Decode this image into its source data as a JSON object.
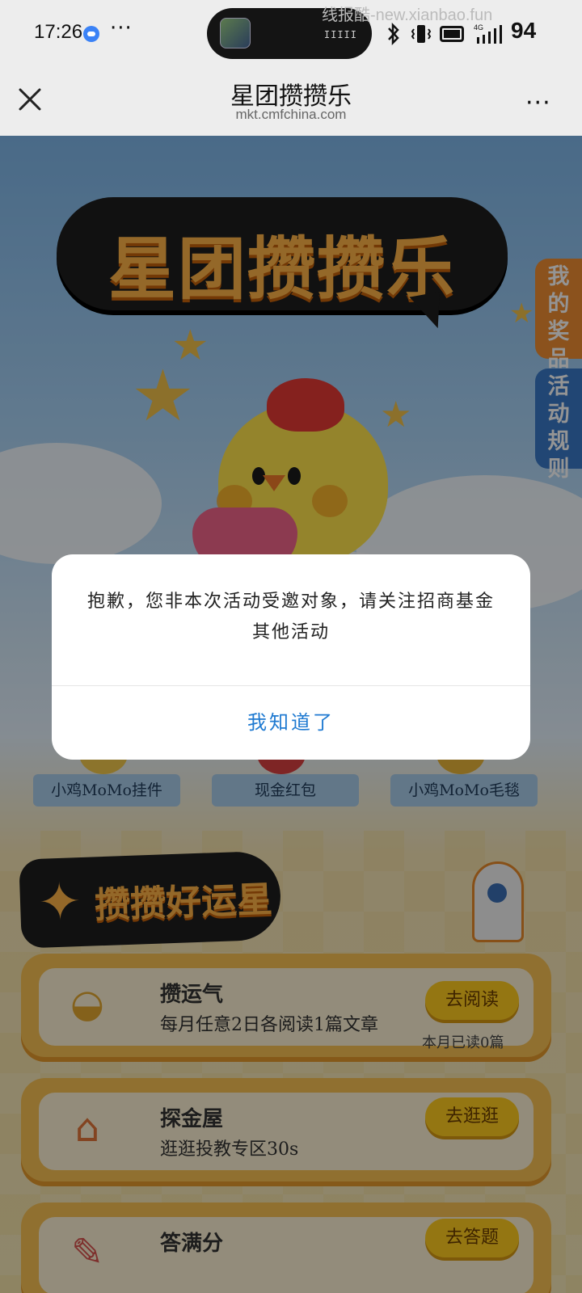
{
  "status_bar": {
    "time": "17:26",
    "more": "···",
    "island_bars": "IIIII",
    "watermark": "线报酷-new.xianbao.fun",
    "network": "4G",
    "battery": "94"
  },
  "nav": {
    "title": "星团攒攒乐",
    "subtitle": "mkt.cmfchina.com",
    "more": "···"
  },
  "banner": {
    "title": "星团攒攒乐"
  },
  "side_tabs": {
    "prizes": "我的奖品",
    "rules": "活动规则"
  },
  "rewards": [
    {
      "label": "小鸡MoMo挂件"
    },
    {
      "label": "现金红包"
    },
    {
      "label": "小鸡MoMo毛毯"
    }
  ],
  "section": {
    "title": "攒攒好运星"
  },
  "tasks": [
    {
      "title": "攒运气",
      "desc": "每月任意2日各阅读1篇文章",
      "button": "去阅读",
      "status": "本月已读0篇",
      "icon": "gold-ingot-icon"
    },
    {
      "title": "探金屋",
      "desc": "逛逛投教专区30s",
      "button": "去逛逛",
      "status": "",
      "icon": "house-icon"
    },
    {
      "title": "答满分",
      "desc": "",
      "button": "去答题",
      "status": "",
      "icon": "quiz-scroll-icon"
    }
  ],
  "dialog": {
    "message": "抱歉，您非本次活动受邀对象，请关注招商基金其他活动",
    "button": "我知道了"
  },
  "colors": {
    "accent_link": "#1f7ad1",
    "title_orange": "#ffb347",
    "button_yellow": "#ffcc1f",
    "tab_orange": "#f08e32",
    "tab_blue": "#3a79c8"
  }
}
